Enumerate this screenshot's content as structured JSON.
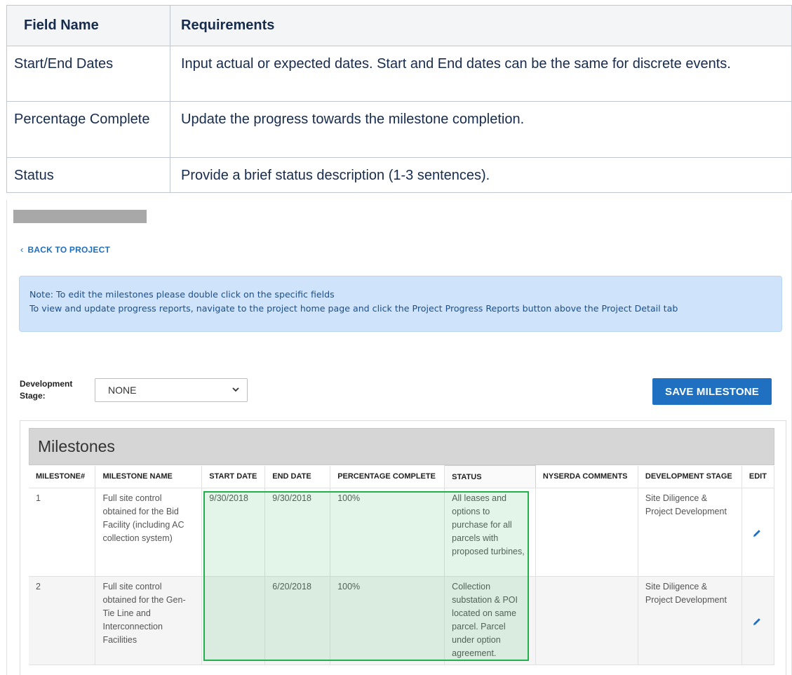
{
  "requirements": {
    "headers": [
      "Field Name",
      "Requirements"
    ],
    "rows": [
      {
        "field": "Start/End Dates",
        "requirement": "Input actual or expected dates. Start and End dates can be the same for discrete events."
      },
      {
        "field": "Percentage Complete",
        "requirement": "Update the progress towards the milestone completion."
      },
      {
        "field": "Status",
        "requirement": "Provide a brief status description (1-3 sentences)."
      }
    ]
  },
  "app": {
    "back_link": "BACK TO PROJECT",
    "note": {
      "line1": "Note: To edit the milestones please double click on the specific fields",
      "line2": "To view and update progress reports, navigate to the project home page and click the Project Progress Reports button above the Project Detail tab"
    },
    "development_stage": {
      "label": "Development Stage:",
      "selected": "NONE"
    },
    "save_button": "SAVE MILESTONE",
    "milestones": {
      "title": "Milestones",
      "columns": [
        "MILESTONE#",
        "MILESTONE NAME",
        "START DATE",
        "END DATE",
        "PERCENTAGE COMPLETE",
        "STATUS",
        "NYSERDA COMMENTS",
        "DEVELOPMENT STAGE",
        "EDIT"
      ],
      "rows": [
        {
          "number": "1",
          "name": "Full site control obtained for the Bid Facility (including AC collection system)",
          "start_date": "9/30/2018",
          "end_date": "9/30/2018",
          "percent": "100%",
          "status": "All leases and options to purchase for all parcels with proposed turbines,",
          "comments": "",
          "stage": "Site Diligence & Project Development"
        },
        {
          "number": "2",
          "name": "Full site control obtained for the Gen-Tie Line and Interconnection Facilities",
          "start_date": "",
          "end_date": "6/20/2018",
          "percent": "100%",
          "status": "Collection substation & POI located on same parcel. Parcel under option agreement.",
          "comments": "",
          "stage": "Site Diligence & Project Development"
        }
      ]
    }
  },
  "icons": {
    "back": "chevron-left-icon",
    "select": "chevron-down-icon",
    "edit": "pencil-icon"
  },
  "colors": {
    "primary": "#1f70c1",
    "note_bg": "#cfe4fb",
    "highlight": "#22b04b"
  }
}
